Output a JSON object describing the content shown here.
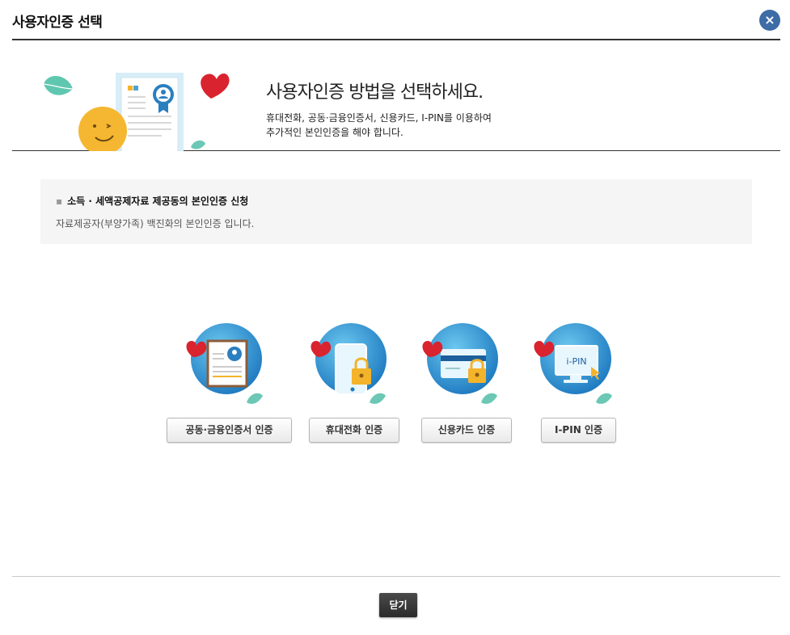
{
  "window": {
    "title": "사용자인증 선택",
    "close_icon": "×"
  },
  "hero": {
    "title": "사용자인증 방법을 선택하세요.",
    "desc_line1": "휴대전화, 공동·금융인증서, 신용카드, I-PIN를 이용하여",
    "desc_line2": "추가적인 본인인증을 해야 합니다."
  },
  "info": {
    "bullet": "▪",
    "title": "소득 · 세액공제자료 제공동의 본인인증 신청",
    "desc": "자료제공자(부양가족) 백진화의 본인인증 입니다."
  },
  "methods": [
    {
      "icon": "certificate-icon",
      "label": "공동·금융인증서 인증"
    },
    {
      "icon": "mobile-phone-lock-icon",
      "label": "휴대전화 인증"
    },
    {
      "icon": "credit-card-lock-icon",
      "label": "신용카드 인증"
    },
    {
      "icon": "ipin-monitor-icon",
      "label": "I-PIN 인증",
      "icon_text": "i-PIN"
    }
  ],
  "footer": {
    "close_label": "닫기"
  },
  "colors": {
    "accent_blue": "#3e6ca6",
    "circle_blue": "#2a8fd0",
    "heart_red": "#d9232f"
  }
}
